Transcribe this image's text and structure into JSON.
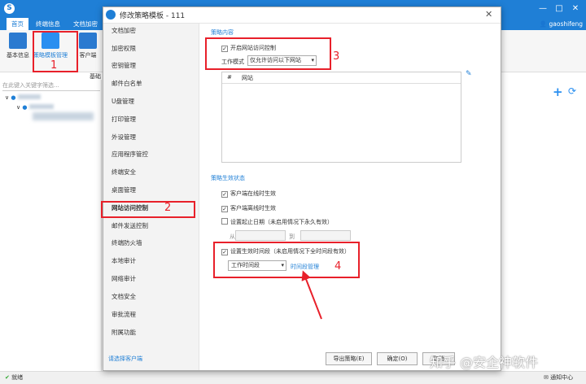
{
  "app": {
    "tabs": [
      "首页",
      "终端信息",
      "文档加密"
    ],
    "user": "gaoshifeng",
    "window_controls": {
      "minimize": "—",
      "maximize": "□",
      "close": "✕"
    }
  },
  "ribbon": {
    "items": [
      "基本信息",
      "策略模板管理",
      "客户端"
    ],
    "sub_label": "基础"
  },
  "left": {
    "search_placeholder": "在此键入关键字筛选...",
    "tree": {
      "root_toggle": "∨",
      "child_toggle": "∨"
    }
  },
  "dialog": {
    "title": "修改策略模板 - 111",
    "close": "✕",
    "nav": [
      "文档加密",
      "加密权限",
      "密钥管理",
      "邮件白名单",
      "U盘管理",
      "打印管理",
      "外设管理",
      "应用程序管控",
      "终端安全",
      "桌面管理",
      "网站访问控制",
      "邮件发送控制",
      "终端防火墙",
      "本地审计",
      "网络审计",
      "文档安全",
      "审批流程",
      "附属功能"
    ],
    "client_link": "请选择客户端",
    "policy_content": {
      "section_title": "策略内容",
      "enable_label": "开启网站访问控制",
      "enable_checked": true,
      "work_mode_label": "工作模式",
      "work_mode_value": "仅允许访问以下网站",
      "list_headers": [
        "#",
        "网站"
      ]
    },
    "policy_status": {
      "section_title": "策略生效状态",
      "online_label": "客户端在线时生效",
      "online_checked": true,
      "offline_label": "客户端离线时生效",
      "offline_checked": true,
      "expiry_label": "设置起止日期（未启用情况下永久有效）",
      "expiry_checked": false,
      "from_label": "从",
      "to_label": "到",
      "time_label": "设置生效时间段（未启用情况下全时间段有效）",
      "time_checked": true,
      "time_value": "工作时间段",
      "time_link": "时间段管理"
    },
    "buttons": {
      "export": "导出策略(E)",
      "ok": "确定(O)",
      "cancel": "取消"
    }
  },
  "annotations": {
    "n1": "1",
    "n2": "2",
    "n3": "3",
    "n4": "4"
  },
  "status": {
    "ready": "就绪",
    "notify": "通知中心"
  },
  "watermark": "知乎 @安企神软件",
  "colors": {
    "brand": "#1f7fd6",
    "annotation": "#e8202a"
  }
}
